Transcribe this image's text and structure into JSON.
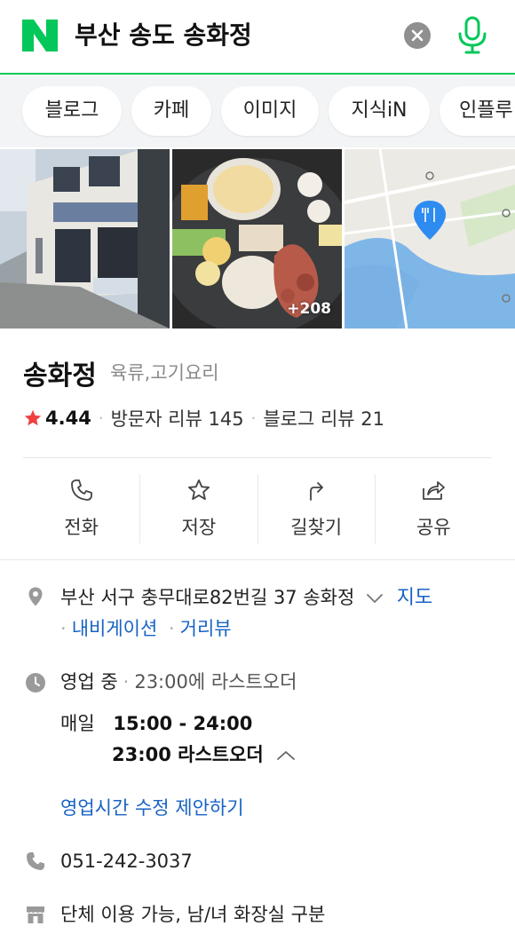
{
  "search": {
    "query": "부산 송도 송화정"
  },
  "tabs": [
    "블로그",
    "카페",
    "이미지",
    "지식iN",
    "인플루"
  ],
  "photos": {
    "more_count": "+208"
  },
  "place": {
    "name": "송화정",
    "category": "육류,고기요리",
    "rating": "4.44",
    "visitor_reviews": "방문자 리뷰 145",
    "blog_reviews": "블로그 리뷰 21"
  },
  "actions": [
    "전화",
    "저장",
    "길찾기",
    "공유"
  ],
  "address": {
    "text": "부산 서구 충무대로82번길 37 송화정",
    "map_link": "지도",
    "navigation_link": "내비게이션",
    "streetview_link": "거리뷰"
  },
  "hours": {
    "status": "영업 중",
    "last_order": "23:00에 라스트오더",
    "day_label": "매일",
    "time_range": "15:00 - 24:00",
    "last_order_detail": "23:00 라스트오더",
    "suggest_edit": "영업시간 수정 제안하기"
  },
  "phone": "051-242-3037",
  "facilities": "단체 이용 가능, 남/녀 화장실 구분",
  "colors": {
    "brand_green": "#03c75a",
    "link_blue": "#1863c4",
    "star_red": "#f04040",
    "map_pin_blue": "#2e8cf0"
  }
}
